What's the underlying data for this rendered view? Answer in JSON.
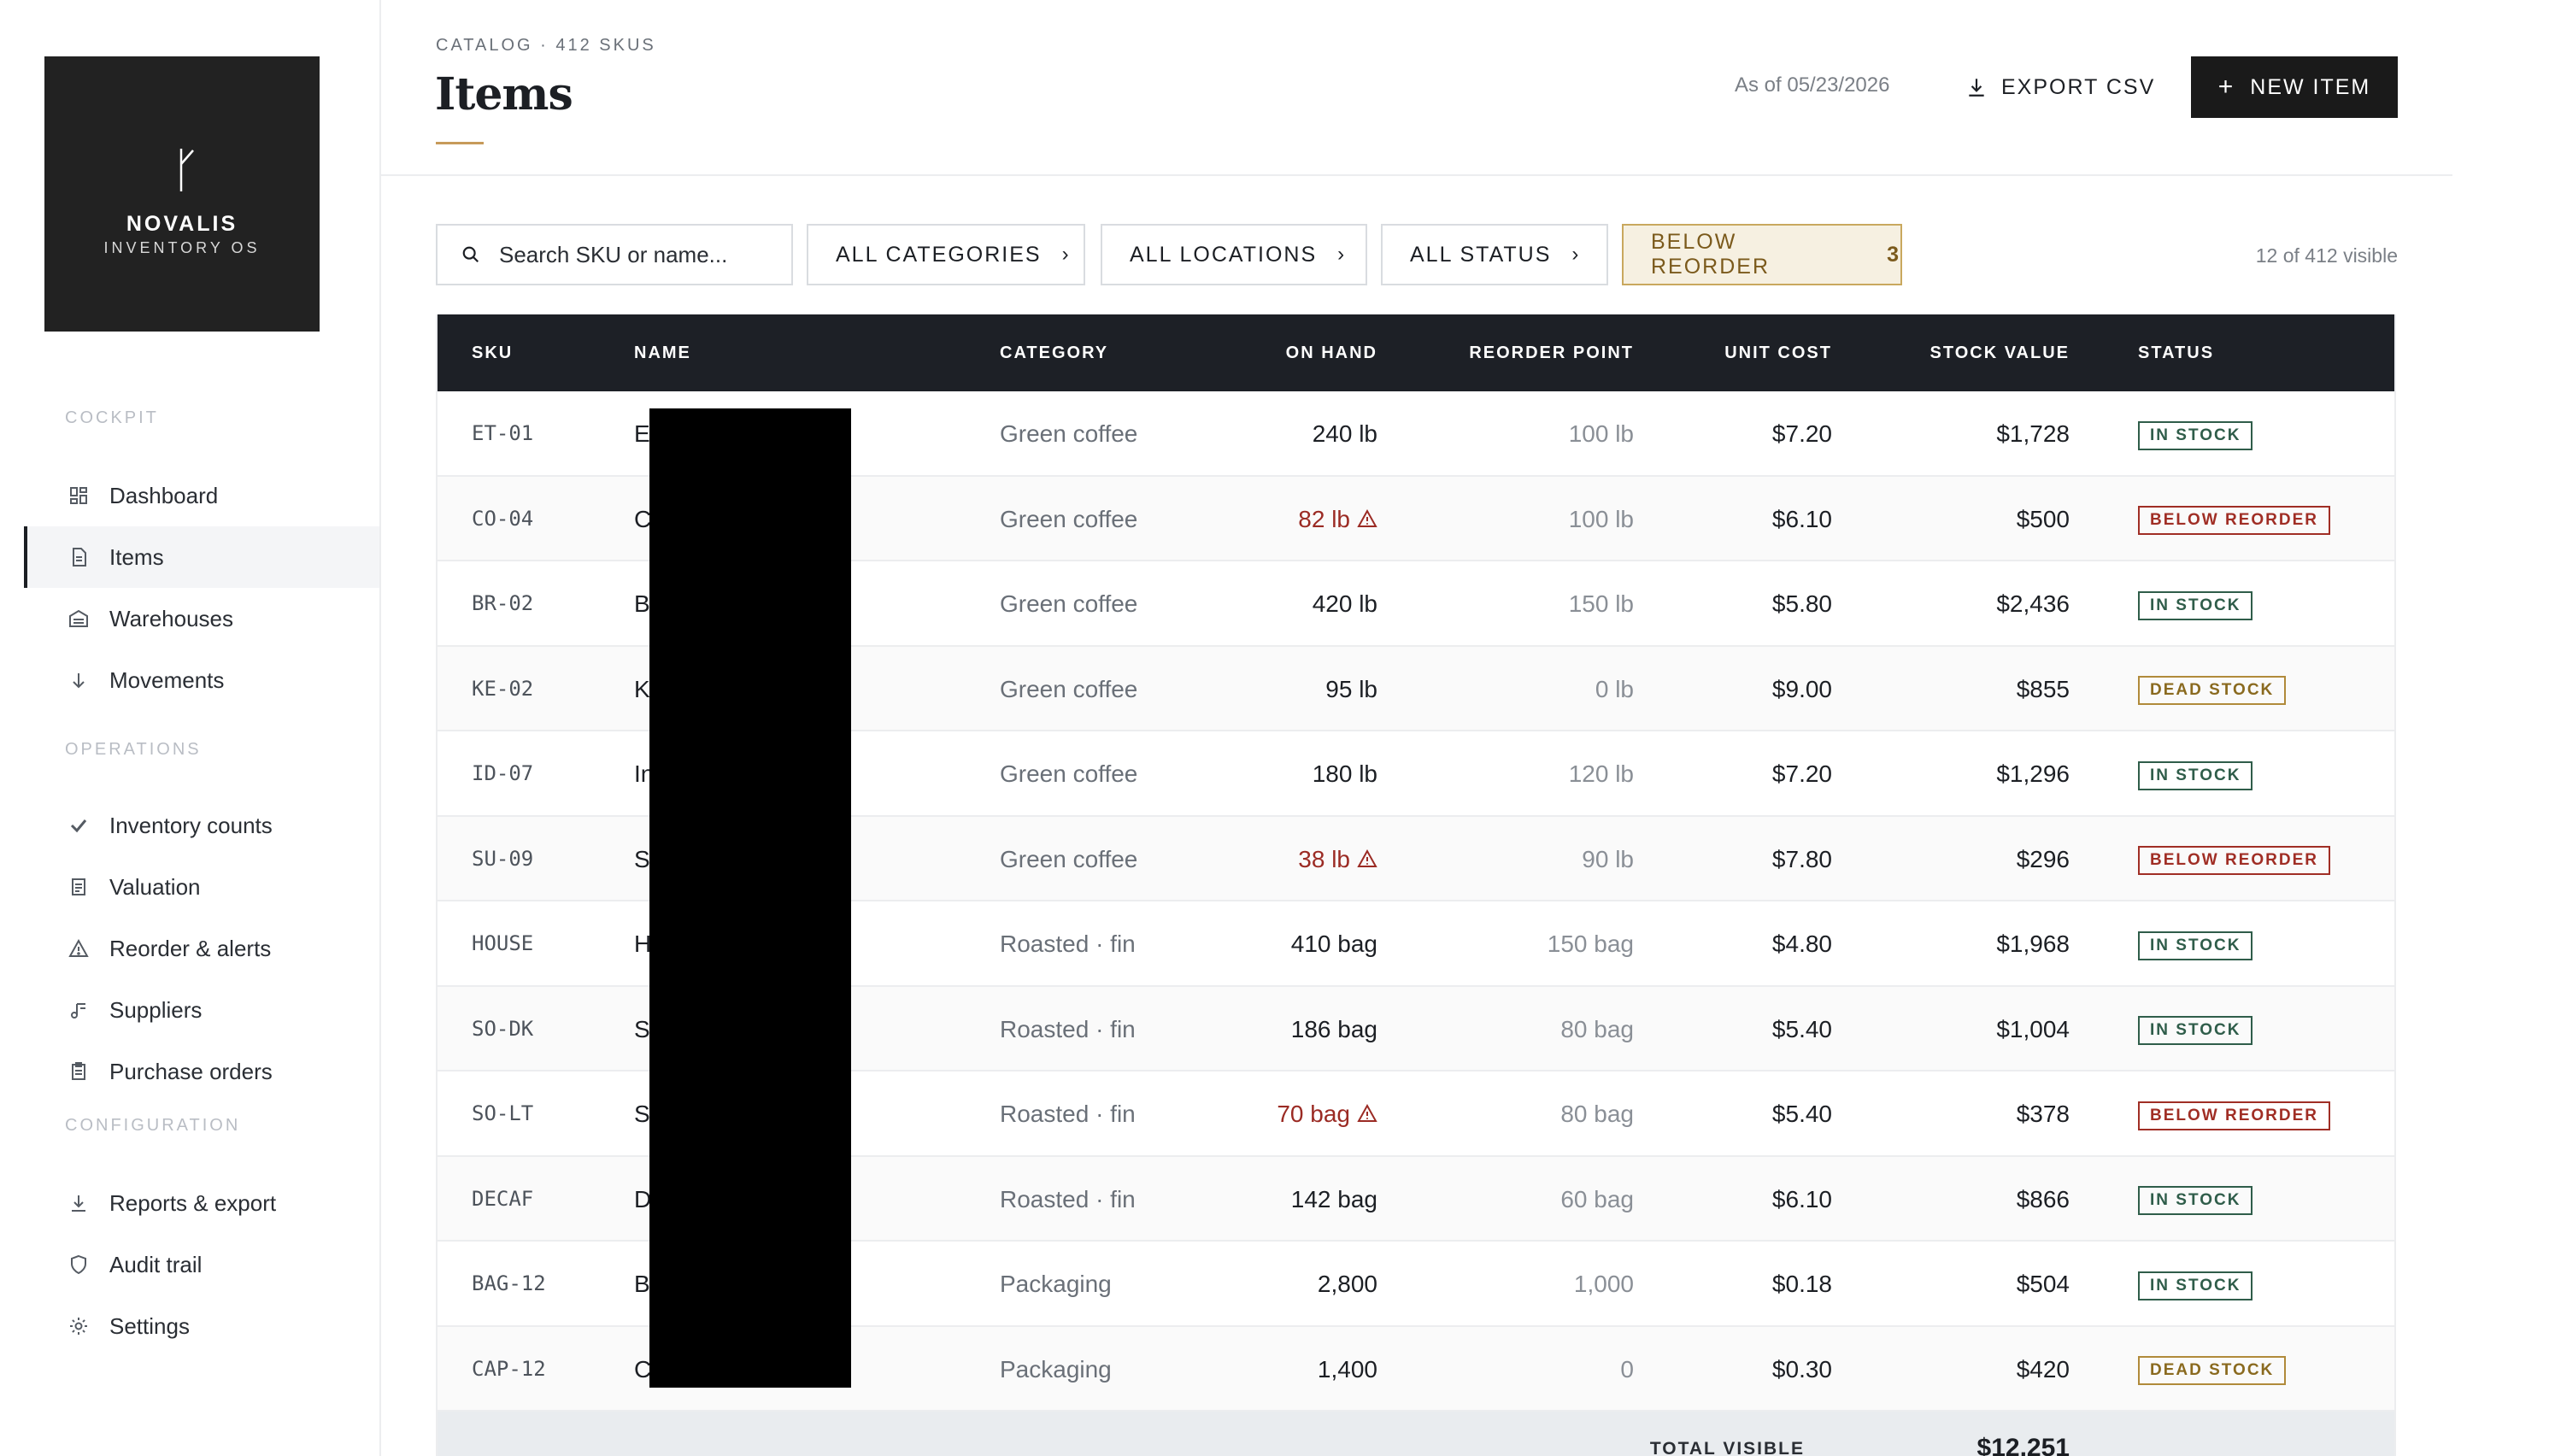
{
  "app": {
    "logo_name": "NOVALIS",
    "logo_sub": "INVENTORY OS"
  },
  "sidebar": {
    "sections": [
      {
        "title": "COCKPIT",
        "items": [
          {
            "label": "Dashboard",
            "icon": "dashboard-icon"
          },
          {
            "label": "Items",
            "icon": "items-icon",
            "active": true
          },
          {
            "label": "Warehouses",
            "icon": "warehouse-icon"
          },
          {
            "label": "Movements",
            "icon": "arrow-down-icon"
          }
        ]
      },
      {
        "title": "OPERATIONS",
        "items": [
          {
            "label": "Inventory counts",
            "icon": "check-icon"
          },
          {
            "label": "Valuation",
            "icon": "document-icon"
          },
          {
            "label": "Reorder & alerts",
            "icon": "warning-icon"
          },
          {
            "label": "Suppliers",
            "icon": "suppliers-icon"
          },
          {
            "label": "Purchase orders",
            "icon": "clipboard-icon"
          }
        ]
      },
      {
        "title": "CONFIGURATION",
        "items": [
          {
            "label": "Reports & export",
            "icon": "download-icon"
          },
          {
            "label": "Audit trail",
            "icon": "shield-icon"
          },
          {
            "label": "Settings",
            "icon": "gear-icon"
          }
        ]
      }
    ]
  },
  "header": {
    "breadcrumb": "CATALOG · 412 SKUS",
    "title": "Items",
    "as_of": "As of 05/23/2026",
    "export_label": "EXPORT CSV",
    "new_item_label": "NEW ITEM"
  },
  "filters": {
    "search_placeholder": "Search SKU or name...",
    "categories": "ALL CATEGORIES",
    "locations": "ALL LOCATIONS",
    "status": "ALL STATUS",
    "below_reorder": "BELOW REORDER",
    "below_reorder_count": "3",
    "visible_count": "12 of 412 visible"
  },
  "table": {
    "columns": [
      "SKU",
      "NAME",
      "CATEGORY",
      "ON HAND",
      "REORDER POINT",
      "UNIT COST",
      "STOCK VALUE",
      "STATUS"
    ],
    "rows": [
      {
        "sku": "ET-01",
        "name": "E",
        "category": "Green coffee",
        "on_hand": "240 lb",
        "low": false,
        "reorder": "100 lb",
        "cost": "$7.20",
        "value": "$1,728",
        "status": "IN STOCK",
        "status_kind": "in"
      },
      {
        "sku": "CO-04",
        "name": "C",
        "category": "Green coffee",
        "on_hand": "82 lb",
        "low": true,
        "reorder": "100 lb",
        "cost": "$6.10",
        "value": "$500",
        "status": "BELOW REORDER",
        "status_kind": "below"
      },
      {
        "sku": "BR-02",
        "name": "B",
        "category": "Green coffee",
        "on_hand": "420 lb",
        "low": false,
        "reorder": "150 lb",
        "cost": "$5.80",
        "value": "$2,436",
        "status": "IN STOCK",
        "status_kind": "in"
      },
      {
        "sku": "KE-02",
        "name": "K",
        "category": "Green coffee",
        "on_hand": "95 lb",
        "low": false,
        "reorder": "0 lb",
        "cost": "$9.00",
        "value": "$855",
        "status": "DEAD STOCK",
        "status_kind": "dead"
      },
      {
        "sku": "ID-07",
        "name": "In",
        "category": "Green coffee",
        "on_hand": "180 lb",
        "low": false,
        "reorder": "120 lb",
        "cost": "$7.20",
        "value": "$1,296",
        "status": "IN STOCK",
        "status_kind": "in"
      },
      {
        "sku": "SU-09",
        "name": "S",
        "category": "Green coffee",
        "on_hand": "38 lb",
        "low": true,
        "reorder": "90 lb",
        "cost": "$7.80",
        "value": "$296",
        "status": "BELOW REORDER",
        "status_kind": "below"
      },
      {
        "sku": "HOUSE",
        "name": "H",
        "category": "Roasted · fin",
        "on_hand": "410 bag",
        "low": false,
        "reorder": "150 bag",
        "cost": "$4.80",
        "value": "$1,968",
        "status": "IN STOCK",
        "status_kind": "in"
      },
      {
        "sku": "SO-DK",
        "name": "S",
        "category": "Roasted · fin",
        "on_hand": "186 bag",
        "low": false,
        "reorder": "80 bag",
        "cost": "$5.40",
        "value": "$1,004",
        "status": "IN STOCK",
        "status_kind": "in"
      },
      {
        "sku": "SO-LT",
        "name": "S",
        "category": "Roasted · fin",
        "on_hand": "70 bag",
        "low": true,
        "reorder": "80 bag",
        "cost": "$5.40",
        "value": "$378",
        "status": "BELOW REORDER",
        "status_kind": "below"
      },
      {
        "sku": "DECAF",
        "name": "D",
        "category": "Roasted · fin",
        "on_hand": "142 bag",
        "low": false,
        "reorder": "60 bag",
        "cost": "$6.10",
        "value": "$866",
        "status": "IN STOCK",
        "status_kind": "in"
      },
      {
        "sku": "BAG-12",
        "name": "B",
        "category": "Packaging",
        "on_hand": "2,800",
        "low": false,
        "reorder": "1,000",
        "cost": "$0.18",
        "value": "$504",
        "status": "IN STOCK",
        "status_kind": "in"
      },
      {
        "sku": "CAP-12",
        "name": "C",
        "category": "Packaging",
        "on_hand": "1,400",
        "low": false,
        "reorder": "0",
        "cost": "$0.30",
        "value": "$420",
        "status": "DEAD STOCK",
        "status_kind": "dead"
      }
    ],
    "footer_label": "TOTAL VISIBLE",
    "footer_value": "$12,251"
  },
  "colors": {
    "accent": "#c79a5a",
    "header_dark": "#1d2026",
    "in_stock": "#2f5d4a",
    "below_reorder": "#a02e25",
    "dead_stock": "#8a6a1f"
  }
}
